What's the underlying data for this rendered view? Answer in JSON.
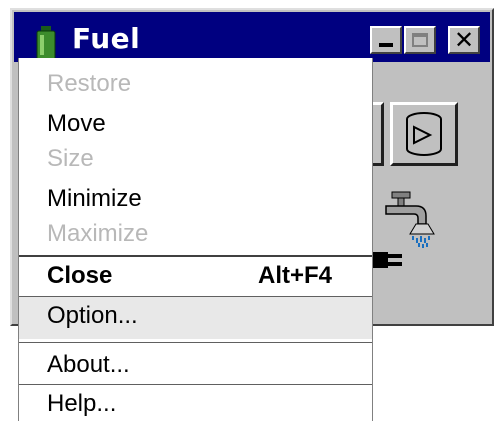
{
  "window": {
    "title": "Fuel",
    "colors": {
      "titlebar": "#000080",
      "face": "#c0c0c0"
    },
    "icons": [
      "fuel-can-icon",
      "minimize-icon",
      "maximize-icon",
      "close-icon",
      "fuel-tank-icon",
      "faucet-icon",
      "plug-icon"
    ]
  },
  "titlebar_buttons": {
    "close_glyph": "✕"
  },
  "menu": {
    "items": [
      {
        "label": "Restore",
        "enabled": false
      },
      {
        "label": "Move",
        "enabled": true
      },
      {
        "label": "Size",
        "enabled": false
      },
      {
        "label": "Minimize",
        "enabled": true
      },
      {
        "label": "Maximize",
        "enabled": false
      },
      {
        "label": "Close",
        "enabled": true,
        "shortcut": "Alt+F4",
        "bold": true
      },
      {
        "label": "Option...",
        "enabled": true,
        "highlighted": true
      },
      {
        "label": "About...",
        "enabled": true
      },
      {
        "label": "Help...",
        "enabled": true
      }
    ]
  }
}
